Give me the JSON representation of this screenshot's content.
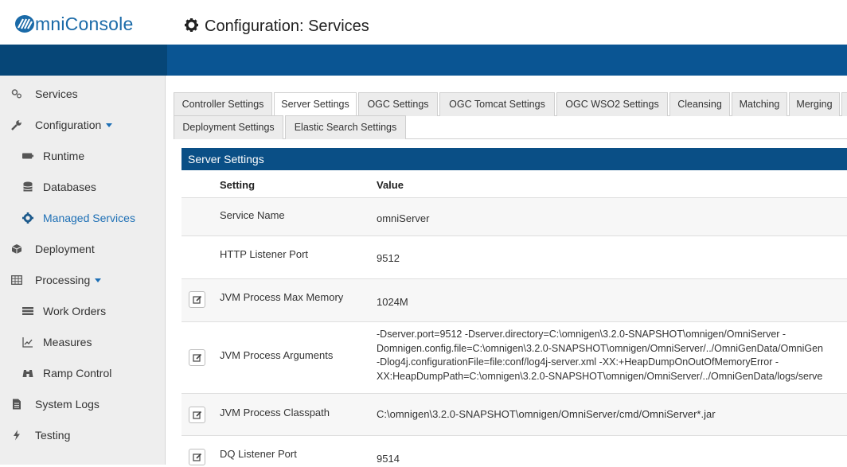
{
  "app": {
    "logo_text": "mniConsole",
    "page_title": "Configuration: Services"
  },
  "colors": {
    "brand_blue": "#0a5593",
    "panel_header": "#0a4f86",
    "active_link": "#1d6fb5"
  },
  "sidebar": {
    "items": [
      {
        "label": "Services",
        "icon": "services-icon"
      },
      {
        "label": "Configuration",
        "icon": "wrench-icon",
        "expanded": true
      },
      {
        "label": "Runtime",
        "icon": "runtime-icon"
      },
      {
        "label": "Databases",
        "icon": "database-icon"
      },
      {
        "label": "Managed Services",
        "icon": "gear-icon",
        "active": true
      },
      {
        "label": "Deployment",
        "icon": "deployment-icon"
      },
      {
        "label": "Processing",
        "icon": "table-icon",
        "expanded": true
      },
      {
        "label": "Work Orders",
        "icon": "list-icon"
      },
      {
        "label": "Measures",
        "icon": "line-chart-icon"
      },
      {
        "label": "Ramp Control",
        "icon": "binoculars-icon"
      },
      {
        "label": "System Logs",
        "icon": "file-icon"
      },
      {
        "label": "Testing",
        "icon": "flash-icon"
      }
    ]
  },
  "tabs": {
    "row1": [
      "Controller Settings",
      "Server Settings",
      "OGC Settings",
      "OGC Tomcat Settings",
      "OGC WSO2 Settings",
      "Cleansing",
      "Matching",
      "Merging"
    ],
    "row2": [
      "Deployment Settings",
      "Elastic Search Settings"
    ],
    "active": "Server Settings"
  },
  "panel": {
    "title": "Server Settings",
    "col_setting": "Setting",
    "col_value": "Value",
    "rows": [
      {
        "setting": "Service Name",
        "value": "omniServer",
        "editable": false
      },
      {
        "setting": "HTTP Listener Port",
        "value": "9512",
        "editable": false
      },
      {
        "setting": "JVM Process Max Memory",
        "value": "1024M",
        "editable": true
      },
      {
        "setting": "JVM Process Arguments",
        "editable": true,
        "value_lines": [
          "-Dserver.port=9512 -Dserver.directory=C:\\omnigen\\3.2.0-SNAPSHOT\\omnigen/OmniServer -",
          "Domnigen.config.file=C:\\omnigen\\3.2.0-SNAPSHOT\\omnigen/OmniServer/../OmniGenData/OmniGen",
          "-Dlog4j.configurationFile=file:conf/log4j-server.xml -XX:+HeapDumpOnOutOfMemoryError -",
          "XX:HeapDumpPath=C:\\omnigen\\3.2.0-SNAPSHOT\\omnigen/OmniServer/../OmniGenData/logs/serve"
        ]
      },
      {
        "setting": "JVM Process Classpath",
        "value": "C:\\omnigen\\3.2.0-SNAPSHOT\\omnigen/OmniServer/cmd/OmniServer*.jar",
        "editable": true
      },
      {
        "setting": "DQ Listener Port",
        "value": "9514",
        "editable": true
      }
    ]
  }
}
